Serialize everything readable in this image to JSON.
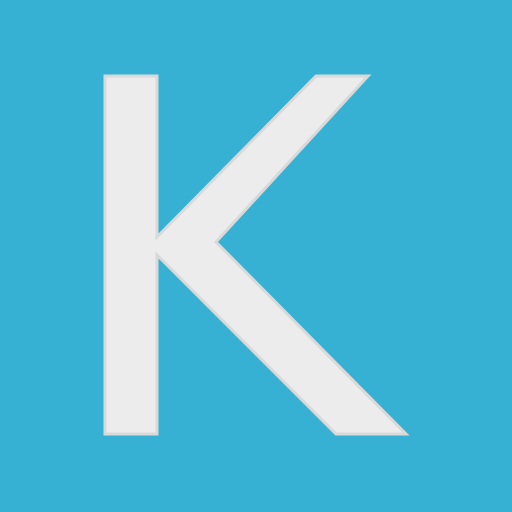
{
  "icon": {
    "letter": "K",
    "background_color": "#36b1d3",
    "glyph_color": "#ececec",
    "glyph_edge_color": "#d9d9d9"
  }
}
